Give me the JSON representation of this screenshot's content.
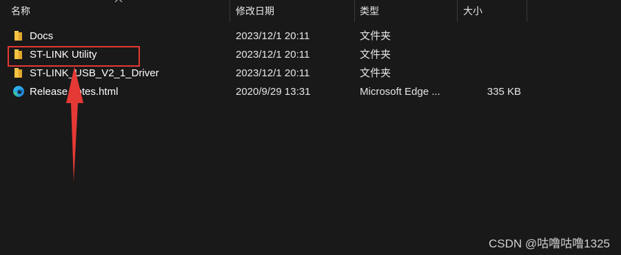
{
  "header": {
    "columns": [
      {
        "label": "名称"
      },
      {
        "label": "修改日期"
      },
      {
        "label": "类型"
      },
      {
        "label": "大小"
      }
    ]
  },
  "files": [
    {
      "name": "Docs",
      "date": "2023/12/1 20:11",
      "type": "文件夹",
      "size": "",
      "icon": "folder-icon"
    },
    {
      "name": "ST-LINK Utility",
      "date": "2023/12/1 20:11",
      "type": "文件夹",
      "size": "",
      "icon": "folder-icon"
    },
    {
      "name": "ST-LINK_USB_V2_1_Driver",
      "date": "2023/12/1 20:11",
      "type": "文件夹",
      "size": "",
      "icon": "folder-icon"
    },
    {
      "name": "Release notes.html",
      "date": "2020/9/29 13:31",
      "type": "Microsoft Edge ...",
      "size": "335 KB",
      "icon": "edge-icon"
    }
  ],
  "watermark": "CSDN @咕噜咕噜1325",
  "colors": {
    "background": "#191919",
    "annotation": "#e53935",
    "folder": "#f5c242"
  }
}
